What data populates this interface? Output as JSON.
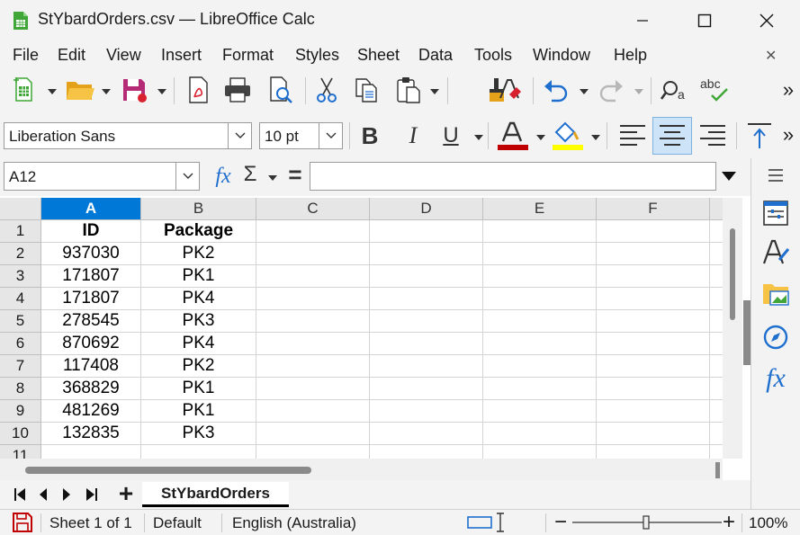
{
  "window": {
    "title": "StYbardOrders.csv — LibreOffice Calc",
    "app_icon": "calc-document-icon",
    "accent": "#0078d7"
  },
  "menubar": {
    "items": [
      "File",
      "Edit",
      "View",
      "Insert",
      "Format",
      "Styles",
      "Sheet",
      "Data",
      "Tools",
      "Window",
      "Help"
    ],
    "close_glyph": "✕"
  },
  "toolbar": {
    "overflow_glyph": "»"
  },
  "formatting": {
    "font_name": "Liberation Sans",
    "font_size": "10 pt",
    "bold": "B",
    "italic": "I",
    "underline": "U",
    "font_color": "#c00000",
    "highlight_color": "#ffff00"
  },
  "formula_bar": {
    "name_box": "A12",
    "fx": "fx",
    "sigma": "Σ",
    "equals": "=",
    "content": ""
  },
  "sheet": {
    "columns": [
      "A",
      "B",
      "C",
      "D",
      "E",
      "F"
    ],
    "selected_column": "A",
    "row_numbers": [
      "1",
      "2",
      "3",
      "4",
      "5",
      "6",
      "7",
      "8",
      "9",
      "10",
      "11"
    ],
    "rows": [
      [
        "ID",
        "Package"
      ],
      [
        "937030",
        "PK2"
      ],
      [
        "171807",
        "PK1"
      ],
      [
        "171807",
        "PK4"
      ],
      [
        "278545",
        "PK3"
      ],
      [
        "870692",
        "PK4"
      ],
      [
        "117408",
        "PK2"
      ],
      [
        "368829",
        "PK1"
      ],
      [
        "481269",
        "PK1"
      ],
      [
        "132835",
        "PK3"
      ],
      [
        "",
        ""
      ]
    ]
  },
  "tabs": {
    "add_glyph": "+",
    "active": "StYbardOrders"
  },
  "statusbar": {
    "sheet": "Sheet 1 of 1",
    "style": "Default",
    "language": "English (Australia)",
    "zoom": "100%",
    "zoom_minus": "−",
    "zoom_plus": "+"
  }
}
